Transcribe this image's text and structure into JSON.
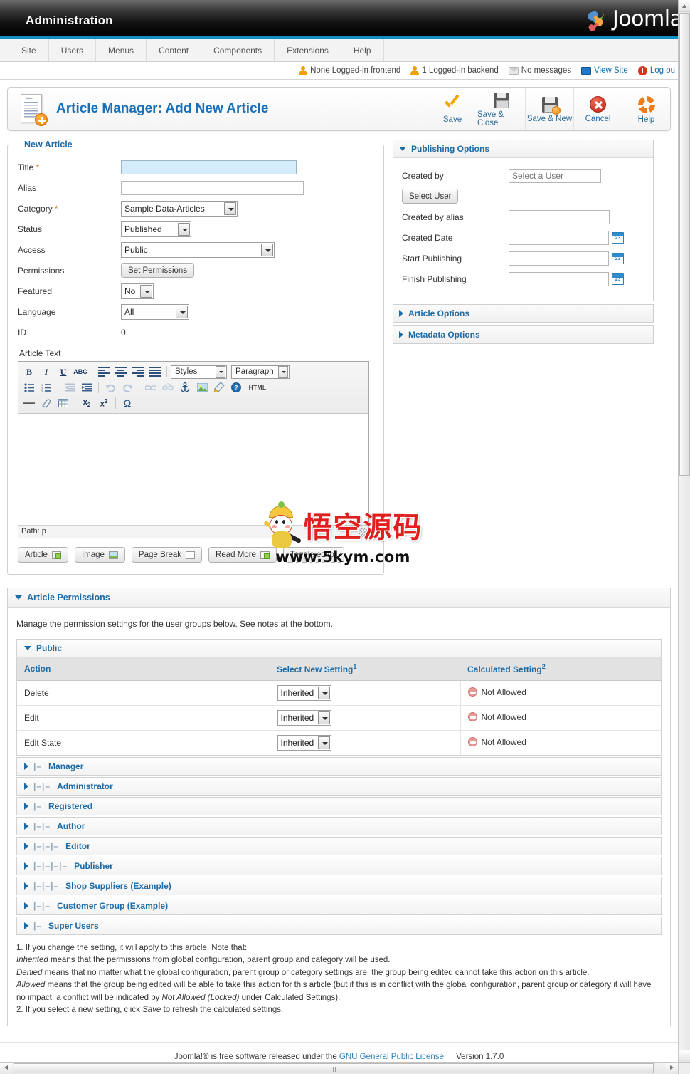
{
  "header": {
    "admin_title": "Administration",
    "brand": "Joomla!"
  },
  "menu": {
    "items": [
      {
        "label": "Site"
      },
      {
        "label": "Users"
      },
      {
        "label": "Menus"
      },
      {
        "label": "Content"
      },
      {
        "label": "Components"
      },
      {
        "label": "Extensions"
      },
      {
        "label": "Help"
      }
    ]
  },
  "status": {
    "frontend": "None Logged-in frontend",
    "backend": "1 Logged-in backend",
    "messages": "No messages",
    "view_site": "View Site",
    "logout": "Log ou"
  },
  "page": {
    "title": "Article Manager: Add New Article"
  },
  "toolbar": {
    "buttons": [
      {
        "label": "Save",
        "icon": "check-icon"
      },
      {
        "label": "Save & Close",
        "icon": "disk-icon"
      },
      {
        "label": "Save & New",
        "icon": "disk-plus-icon"
      },
      {
        "label": "Cancel",
        "icon": "cancel-icon"
      },
      {
        "label": "Help",
        "icon": "help-icon"
      }
    ]
  },
  "new_article": {
    "legend": "New Article",
    "fields": {
      "title_label": "Title",
      "title_value": "",
      "alias_label": "Alias",
      "alias_value": "",
      "category_label": "Category",
      "category_value": "Sample Data-Articles",
      "status_label": "Status",
      "status_value": "Published",
      "access_label": "Access",
      "access_value": "Public",
      "permissions_label": "Permissions",
      "permissions_button": "Set Permissions",
      "featured_label": "Featured",
      "featured_value": "No",
      "language_label": "Language",
      "language_value": "All",
      "id_label": "ID",
      "id_value": "0"
    },
    "article_text_label": "Article Text",
    "editor": {
      "styles_value": "Styles",
      "format_value": "Paragraph",
      "html_label": "HTML",
      "path": "Path: p",
      "buttons": [
        {
          "label": "Article",
          "icon": "article-insert-icon"
        },
        {
          "label": "Image",
          "icon": "image-insert-icon"
        },
        {
          "label": "Page Break",
          "icon": "page-break-icon"
        },
        {
          "label": "Read More",
          "icon": "read-more-icon"
        },
        {
          "label": "Toggle editor",
          "icon": ""
        }
      ]
    }
  },
  "publishing": {
    "header": "Publishing Options",
    "created_by_label": "Created by",
    "created_by_placeholder": "Select a User",
    "select_user_button": "Select User",
    "created_by_alias_label": "Created by alias",
    "created_by_alias_value": "",
    "created_date_label": "Created Date",
    "created_date_value": "",
    "start_publishing_label": "Start Publishing",
    "start_publishing_value": "",
    "finish_publishing_label": "Finish Publishing",
    "finish_publishing_value": ""
  },
  "collapsed_panels": [
    {
      "header": "Article Options"
    },
    {
      "header": "Metadata Options"
    }
  ],
  "permissions": {
    "header": "Article Permissions",
    "intro": "Manage the permission settings for the user groups below. See notes at the bottom.",
    "public_group": "Public",
    "columns": {
      "action": "Action",
      "select_new": "Select New Setting",
      "select_new_sup": "1",
      "calculated": "Calculated Setting",
      "calculated_sup": "2"
    },
    "rows": [
      {
        "action": "Delete",
        "setting": "Inherited",
        "calculated": "Not Allowed"
      },
      {
        "action": "Edit",
        "setting": "Inherited",
        "calculated": "Not Allowed"
      },
      {
        "action": "Edit State",
        "setting": "Inherited",
        "calculated": "Not Allowed"
      }
    ],
    "groups": [
      {
        "label": "Manager",
        "depth": 1
      },
      {
        "label": "Administrator",
        "depth": 2
      },
      {
        "label": "Registered",
        "depth": 1
      },
      {
        "label": "Author",
        "depth": 2
      },
      {
        "label": "Editor",
        "depth": 3
      },
      {
        "label": "Publisher",
        "depth": 4
      },
      {
        "label": "Shop Suppliers (Example)",
        "depth": 3
      },
      {
        "label": "Customer Group (Example)",
        "depth": 2
      },
      {
        "label": "Super Users",
        "depth": 1
      }
    ],
    "notes": {
      "n1": "1. If you change the setting, it will apply to this article. Note that:",
      "n2_em": "Inherited",
      "n2": " means that the permissions from global configuration, parent group and category will be used.",
      "n3_em": "Denied",
      "n3": " means that no matter what the global configuration, parent group or category settings are, the group being edited cannot take this action on this article.",
      "n4_em": "Allowed",
      "n4a": " means that the group being edited will be able to take this action for this article (but if this is in conflict with the global configuration, parent group or category it will have no impact; a conflict will be indicated by ",
      "n4_em2": "Not Allowed (Locked)",
      "n4b": " under Calculated Settings).",
      "n5a": "2. If you select a new setting, click ",
      "n5_em": "Save",
      "n5b": " to refresh the calculated settings."
    }
  },
  "footer": {
    "text_a": "Joomla!® is free software released under the ",
    "license_link": "GNU General Public License.",
    "version": "Version 1.7.0"
  },
  "watermark": {
    "chinese": "悟空源码",
    "url": "www.5kym.com"
  }
}
